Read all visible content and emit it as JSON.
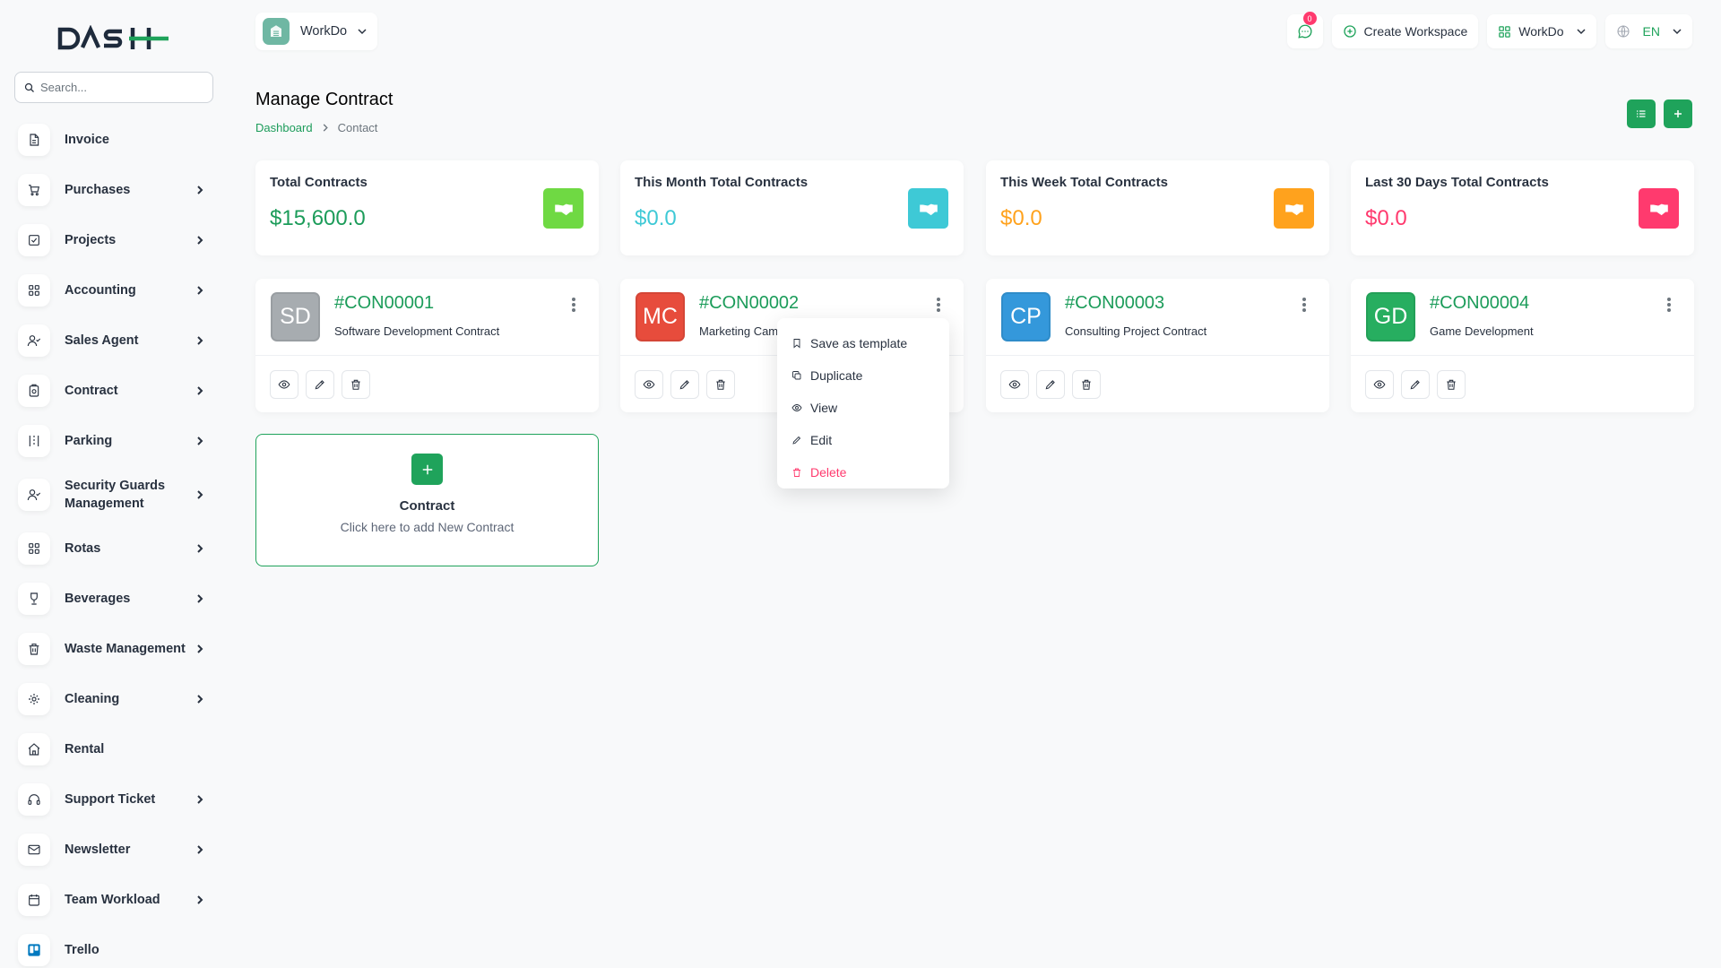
{
  "brand": {
    "logo_text": "DASH"
  },
  "search": {
    "placeholder": "Search..."
  },
  "sidebar": {
    "items": [
      {
        "label": "Invoice",
        "icon": "file-icon",
        "has_chevron": false
      },
      {
        "label": "Purchases",
        "icon": "cart-icon",
        "has_chevron": true
      },
      {
        "label": "Projects",
        "icon": "check-square-icon",
        "has_chevron": true
      },
      {
        "label": "Accounting",
        "icon": "grid-icon",
        "has_chevron": true
      },
      {
        "label": "Sales Agent",
        "icon": "user-check-icon",
        "has_chevron": true
      },
      {
        "label": "Contract",
        "icon": "contract-icon",
        "has_chevron": true
      },
      {
        "label": "Parking",
        "icon": "parking-icon",
        "has_chevron": true
      },
      {
        "label": "Security Guards Management",
        "icon": "user-check-icon",
        "has_chevron": true
      },
      {
        "label": "Rotas",
        "icon": "grid-icon",
        "has_chevron": true
      },
      {
        "label": "Beverages",
        "icon": "cup-icon",
        "has_chevron": true
      },
      {
        "label": "Waste Management",
        "icon": "trash-icon",
        "has_chevron": true
      },
      {
        "label": "Cleaning",
        "icon": "sparkle-icon",
        "has_chevron": true
      },
      {
        "label": "Rental",
        "icon": "home-icon",
        "has_chevron": false
      },
      {
        "label": "Support Ticket",
        "icon": "headphones-icon",
        "has_chevron": true
      },
      {
        "label": "Newsletter",
        "icon": "mail-icon",
        "has_chevron": true
      },
      {
        "label": "Team Workload",
        "icon": "calendar-icon",
        "has_chevron": true
      },
      {
        "label": "Trello",
        "icon": "trello-icon",
        "has_chevron": false
      }
    ]
  },
  "header": {
    "workspace_name": "WorkDo",
    "notification_count": "0",
    "create_workspace_label": "Create Workspace",
    "workspace_menu_label": "WorkDo",
    "language_label": "EN"
  },
  "page": {
    "title": "Manage Contract",
    "breadcrumb": {
      "home": "Dashboard",
      "current": "Contact"
    }
  },
  "stats": [
    {
      "label": "Total Contracts",
      "value": "$15,600.0",
      "color": "#1c9c5a",
      "icon_bg": "#6fd943"
    },
    {
      "label": "This Month Total Contracts",
      "value": "$0.0",
      "color": "#3ec9d6",
      "icon_bg": "#3ec9d6"
    },
    {
      "label": "This Week Total Contracts",
      "value": "$0.0",
      "color": "#ffa21d",
      "icon_bg": "#ffa21d"
    },
    {
      "label": "Last 30 Days Total Contracts",
      "value": "$0.0",
      "color": "#ff3a6e",
      "icon_bg": "#ff3a6e"
    }
  ],
  "contracts": [
    {
      "initials": "SD",
      "code": "#CON00001",
      "name": "Software Development Contract",
      "avatar_color": "#a7acb0"
    },
    {
      "initials": "MC",
      "code": "#CON00002",
      "name": "Marketing Cam",
      "avatar_color": "#e74c3c"
    },
    {
      "initials": "CP",
      "code": "#CON00003",
      "name": "Consulting Project Contract",
      "avatar_color": "#3498db"
    },
    {
      "initials": "GD",
      "code": "#CON00004",
      "name": "Game Development",
      "avatar_color": "#27ae60"
    }
  ],
  "add_card": {
    "title": "Contract",
    "subtitle": "Click here to add New Contract"
  },
  "dropdown": {
    "items": [
      {
        "label": "Save as template",
        "icon": "bookmark-icon"
      },
      {
        "label": "Duplicate",
        "icon": "copy-icon"
      },
      {
        "label": "View",
        "icon": "eye-icon"
      },
      {
        "label": "Edit",
        "icon": "pencil-icon"
      },
      {
        "label": "Delete",
        "icon": "trash-icon"
      }
    ]
  }
}
